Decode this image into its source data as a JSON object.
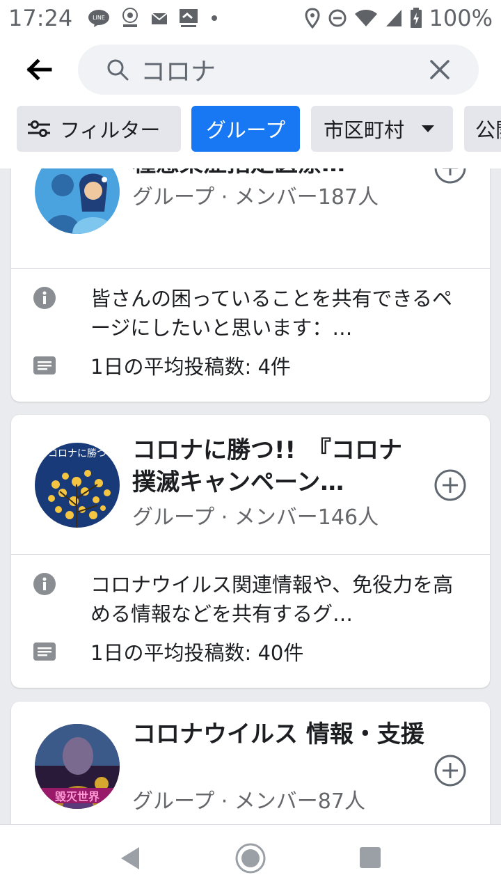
{
  "status_bar": {
    "time": "17:24",
    "battery": "100%",
    "left_icons": [
      "line-icon",
      "app-badge-icon",
      "mail-icon",
      "news-app-icon",
      "dot-icon"
    ],
    "right_icons": [
      "location-icon",
      "do-not-disturb-icon",
      "wifi-icon",
      "signal-icon",
      "battery-charging-icon"
    ]
  },
  "search": {
    "query": "コロナ",
    "back_icon": "arrow-left-icon",
    "clear_icon": "close-icon"
  },
  "chips": {
    "filter": "フィルター",
    "group": "グループ",
    "city": "市区町村",
    "public": "公開"
  },
  "colors": {
    "accent": "#1877f2",
    "text_primary": "#1c1e21",
    "text_secondary": "#65676b",
    "background": "#e9ebee"
  },
  "cards": [
    {
      "name": "新型コロナウイルス・第二種感染症指定医療…",
      "meta": "グループ · メンバー187人",
      "description": "皆さんの困っていることを共有できるページにしたいと思います：…",
      "posts": "1日の平均投稿数: 4件"
    },
    {
      "name": "コロナに勝つ!!　『コロナ撲滅キャンペーン…",
      "meta": "グループ · メンバー146人",
      "description": "コロナウイルス関連情報や、免役力を高める情報などを共有するグ…",
      "posts": "1日の平均投稿数: 40件",
      "avatar_text": "コロナに勝つ"
    },
    {
      "name": "コロナウイルス 情報・支援",
      "meta": "グループ · メンバー87人",
      "avatar_text": "毀灭世界"
    }
  ],
  "nav": {
    "back": "nav-back-icon",
    "home": "nav-home-icon",
    "recents": "nav-recents-icon"
  }
}
